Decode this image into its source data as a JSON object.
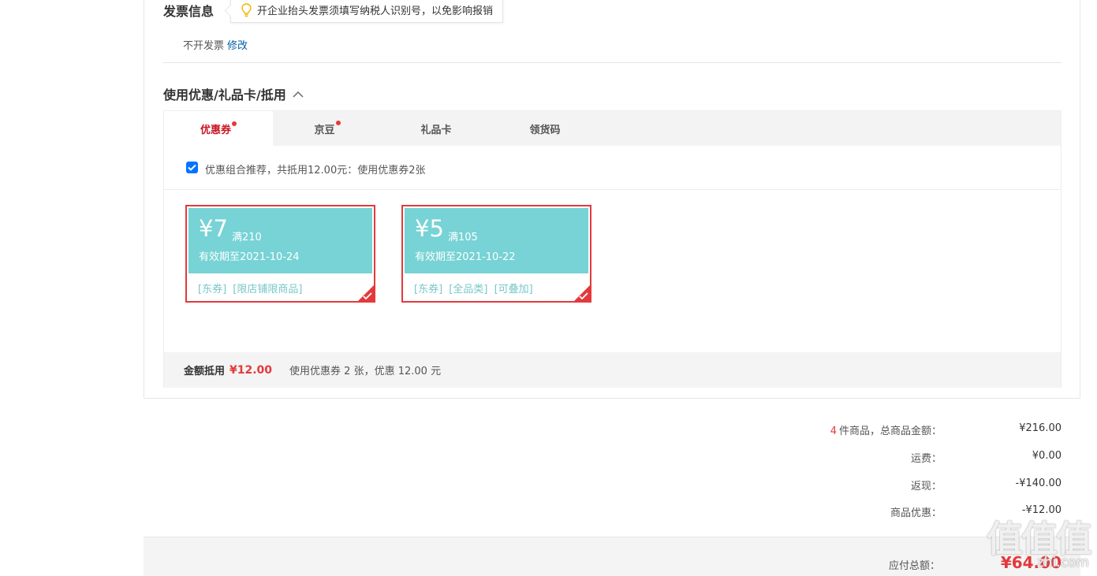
{
  "invoice": {
    "title": "发票信息",
    "tip": "开企业抬头发票须填写纳税人识别号，以免影响报销",
    "status": "不开发票",
    "edit_label": "修改"
  },
  "coupon_section": {
    "title": "使用优惠/礼品卡/抵用",
    "tabs": [
      {
        "label": "优惠券",
        "has_dot": true,
        "active": true
      },
      {
        "label": "京豆",
        "has_dot": true,
        "active": false
      },
      {
        "label": "礼品卡",
        "has_dot": false,
        "active": false
      },
      {
        "label": "领货码",
        "has_dot": false,
        "active": false
      }
    ],
    "recommend_text": "优惠组合推荐，共抵用12.00元：使用优惠券2张",
    "recommend_checked": true,
    "coupons": [
      {
        "amount": "¥7",
        "condition": "满210",
        "valid": "有效期至2021-10-24",
        "tags": [
          "[东券]",
          "[限店铺限商品]"
        ],
        "selected": true
      },
      {
        "amount": "¥5",
        "condition": "满105",
        "valid": "有效期至2021-10-22",
        "tags": [
          "[东券]",
          "[全品类]",
          "[可叠加]"
        ],
        "selected": true
      }
    ],
    "summary": {
      "label": "金额抵用",
      "amount": "¥12.00",
      "detail": "使用优惠券 2 张，优惠 12.00 元"
    }
  },
  "totals": {
    "items_count": "4",
    "items_label": "件商品，总商品金额：",
    "items_value": "¥216.00",
    "shipping_label": "运费：",
    "shipping_value": "¥0.00",
    "cashback_label": "返现：",
    "cashback_value": "-¥140.00",
    "discount_label": "商品优惠：",
    "discount_value": "-¥12.00",
    "payable_label": "应付总额：",
    "payable_value": "¥64.00"
  },
  "watermark": {
    "glyphs": "值值值",
    "text": "zhi.com"
  },
  "colors": {
    "accent_red": "#e4393c",
    "coupon_teal": "#77d3d5",
    "link_blue": "#005ea7"
  }
}
